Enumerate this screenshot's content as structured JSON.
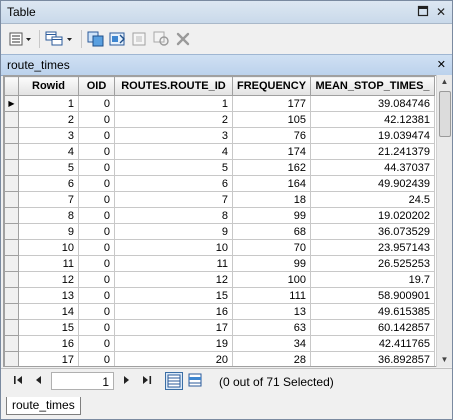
{
  "window": {
    "title": "Table"
  },
  "title_buttons": {
    "close": "✕"
  },
  "tab": {
    "label": "route_times",
    "close": "✕"
  },
  "table": {
    "columns": [
      "Rowid",
      "OID",
      "ROUTES.ROUTE_ID",
      "FREQUENCY",
      "MEAN_STOP_TIMES_"
    ],
    "rows": [
      [
        "1",
        "0",
        "1",
        "177",
        "39.084746"
      ],
      [
        "2",
        "0",
        "2",
        "105",
        "42.12381"
      ],
      [
        "3",
        "0",
        "3",
        "76",
        "19.039474"
      ],
      [
        "4",
        "0",
        "4",
        "174",
        "21.241379"
      ],
      [
        "5",
        "0",
        "5",
        "162",
        "44.37037"
      ],
      [
        "6",
        "0",
        "6",
        "164",
        "49.902439"
      ],
      [
        "7",
        "0",
        "7",
        "18",
        "24.5"
      ],
      [
        "8",
        "0",
        "8",
        "99",
        "19.020202"
      ],
      [
        "9",
        "0",
        "9",
        "68",
        "36.073529"
      ],
      [
        "10",
        "0",
        "10",
        "70",
        "23.957143"
      ],
      [
        "11",
        "0",
        "11",
        "99",
        "26.525253"
      ],
      [
        "12",
        "0",
        "12",
        "100",
        "19.7"
      ],
      [
        "13",
        "0",
        "15",
        "111",
        "58.900901"
      ],
      [
        "14",
        "0",
        "16",
        "13",
        "49.615385"
      ],
      [
        "15",
        "0",
        "17",
        "63",
        "60.142857"
      ],
      [
        "16",
        "0",
        "19",
        "34",
        "42.411765"
      ],
      [
        "17",
        "0",
        "20",
        "28",
        "36.892857"
      ]
    ]
  },
  "status": {
    "current_record": "1",
    "selection": "(0 out of 71 Selected)"
  },
  "bottom_tab": {
    "label": "route_times"
  },
  "colors": {
    "tab_bar": "#c7dbf1",
    "title_bar": "#d5e2f0",
    "header": "#e8e8e8"
  }
}
